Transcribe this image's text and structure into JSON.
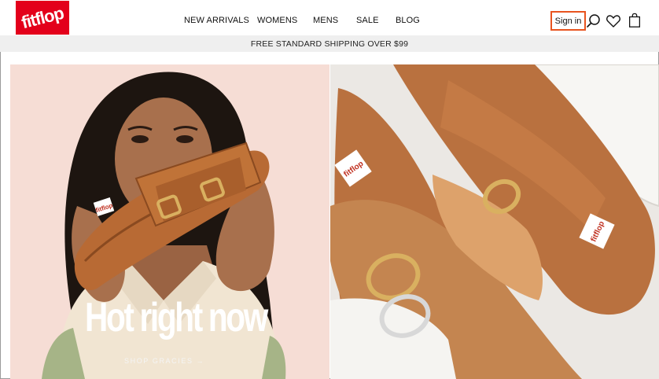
{
  "brand": {
    "logo_text": "fitflop",
    "logo_color": "#e3001b"
  },
  "nav": {
    "items": [
      {
        "label": "NEW ARRIVALS"
      },
      {
        "label": "WOMENS"
      },
      {
        "label": "MENS"
      },
      {
        "label": "SALE"
      },
      {
        "label": "BLOG"
      }
    ]
  },
  "header_actions": {
    "signin_label": "Sign in",
    "accent_color": "#e8541f",
    "icons": [
      "search-icon",
      "heart-icon",
      "bag-icon"
    ]
  },
  "promo_bar": {
    "text": "FREE STANDARD SHIPPING OVER $99"
  },
  "hero": {
    "title": "Hot right now",
    "cta": "SHOP GRACIES →",
    "left_bg": "#f6ddd5",
    "product_color": "#b86a34",
    "shoe_logo_text": "fitflop"
  }
}
